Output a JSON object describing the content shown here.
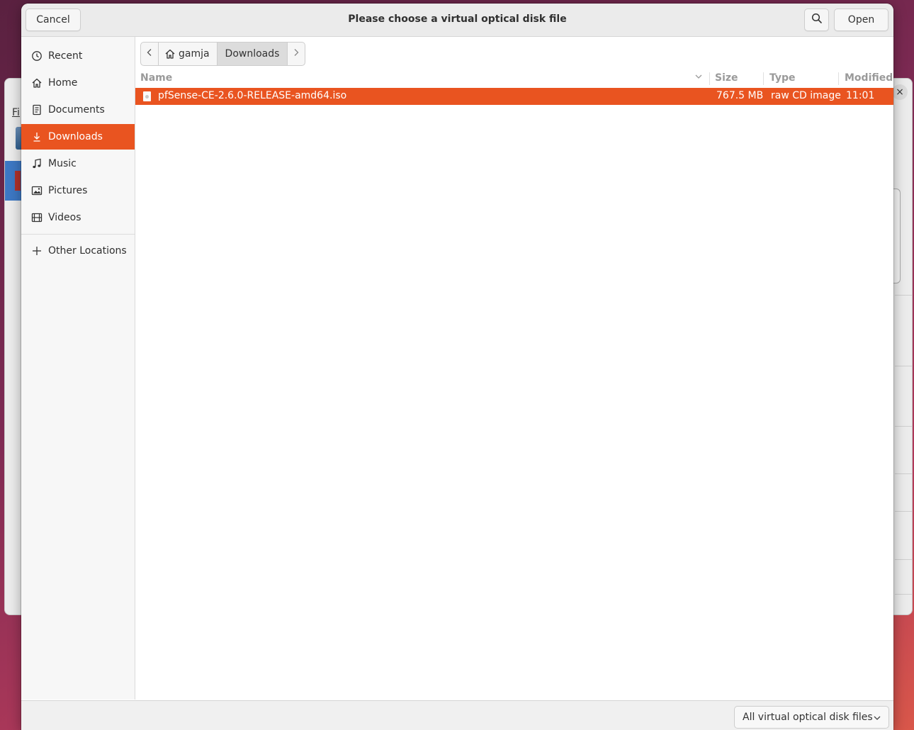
{
  "background_window": {
    "menu_fragment": "Fi",
    "close_glyph": "×"
  },
  "dialog": {
    "title": "Please choose a virtual optical disk file",
    "cancel_label": "Cancel",
    "open_label": "Open",
    "search_icon": "search-icon"
  },
  "sidebar": {
    "items": [
      {
        "label": "Recent",
        "icon": "clock-icon",
        "active": false
      },
      {
        "label": "Home",
        "icon": "home-icon",
        "active": false
      },
      {
        "label": "Documents",
        "icon": "document-icon",
        "active": false
      },
      {
        "label": "Downloads",
        "icon": "download-icon",
        "active": true
      },
      {
        "label": "Music",
        "icon": "music-icon",
        "active": false
      },
      {
        "label": "Pictures",
        "icon": "picture-icon",
        "active": false
      },
      {
        "label": "Videos",
        "icon": "film-icon",
        "active": false
      }
    ],
    "other_locations": {
      "label": "Other Locations",
      "icon": "plus-icon"
    }
  },
  "pathbar": {
    "segments": [
      "gamja",
      "Downloads"
    ],
    "current": "Downloads"
  },
  "filelist": {
    "columns": [
      "Name",
      "Size",
      "Type",
      "Modified"
    ],
    "rows": [
      {
        "name": "pfSense-CE-2.6.0-RELEASE-amd64.iso",
        "size": "767.5 MB",
        "type": "raw CD image",
        "modified": "11:01",
        "selected": true
      }
    ]
  },
  "footer": {
    "filter_label": "All virtual optical disk files"
  },
  "colors": {
    "accent": "#e95420",
    "headerbar": "#ebebeb",
    "sidebar": "#f7f7f7"
  }
}
